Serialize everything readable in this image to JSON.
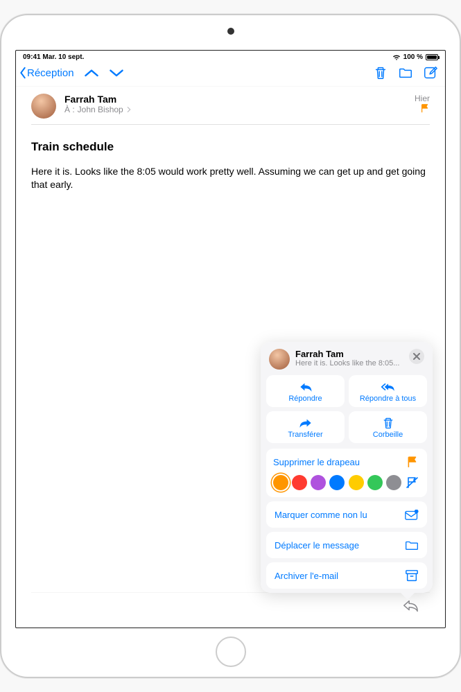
{
  "status": {
    "time": "09:41",
    "date": "Mar. 10 sept.",
    "battery": "100 %"
  },
  "nav": {
    "back": "Réception"
  },
  "message": {
    "sender": "Farrah Tam",
    "recipient_prefix": "À :",
    "recipient": "John Bishop",
    "date": "Hier",
    "subject": "Train schedule",
    "body": "Here it is. Looks like the 8:05 would work pretty well. Assuming we can get up and get going that early."
  },
  "popup": {
    "sender": "Farrah Tam",
    "preview": "Here it is. Looks like the 8:05...",
    "actions": {
      "reply": "Répondre",
      "reply_all": "Répondre à tous",
      "forward": "Transférer",
      "trash": "Corbeille"
    },
    "rows": {
      "remove_flag": "Supprimer le drapeau",
      "mark_unread": "Marquer comme non lu",
      "move": "Déplacer le message",
      "archive": "Archiver l'e-mail"
    },
    "flag_colors": [
      "#ff9500",
      "#ff3b30",
      "#af52de",
      "#007aff",
      "#ffcc00",
      "#34c759",
      "#8e8e93"
    ],
    "selected_color_index": 0
  }
}
